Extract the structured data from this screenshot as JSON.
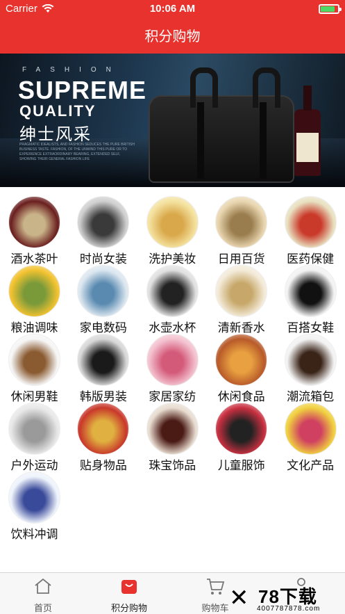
{
  "status_bar": {
    "carrier": "Carrier",
    "time": "10:06 AM",
    "battery_level": 0.85
  },
  "nav": {
    "title": "积分购物"
  },
  "banner": {
    "fashion_text": "FASHION",
    "headline_1": "SUPREME",
    "headline_2": "QUALITY",
    "headline_cn": "绅士风采",
    "small_print": "PRAGMATIC IDEALISTS, AND FASHION SEDUCES THE PURE BRITISH BUSINESS TASTE. FASHION, OF THE UNWIND THIS PURE OR TO EXPERIENCE EXTRAORDINARY BEARING, EXTENDED SELF, SHOWING THEIR GENERAL FASHION LIFE"
  },
  "categories": [
    {
      "label": "酒水茶叶",
      "icon": "wine-tea-icon"
    },
    {
      "label": "时尚女装",
      "icon": "womens-fashion-icon"
    },
    {
      "label": "洗护美妆",
      "icon": "beauty-care-icon"
    },
    {
      "label": "日用百货",
      "icon": "daily-goods-icon"
    },
    {
      "label": "医药保健",
      "icon": "health-medicine-icon"
    },
    {
      "label": "粮油调味",
      "icon": "grain-oil-icon"
    },
    {
      "label": "家电数码",
      "icon": "appliance-digital-icon"
    },
    {
      "label": "水壶水杯",
      "icon": "kettle-cup-icon"
    },
    {
      "label": "清新香水",
      "icon": "perfume-icon"
    },
    {
      "label": "百搭女鞋",
      "icon": "womens-shoes-icon"
    },
    {
      "label": "休闲男鞋",
      "icon": "mens-shoes-icon"
    },
    {
      "label": "韩版男装",
      "icon": "mens-fashion-icon"
    },
    {
      "label": "家居家纺",
      "icon": "home-textile-icon"
    },
    {
      "label": "休闲食品",
      "icon": "snack-food-icon"
    },
    {
      "label": "潮流箱包",
      "icon": "bags-icon"
    },
    {
      "label": "户外运动",
      "icon": "outdoor-sports-icon"
    },
    {
      "label": "贴身物品",
      "icon": "intimate-items-icon"
    },
    {
      "label": "珠宝饰品",
      "icon": "jewelry-icon"
    },
    {
      "label": "儿童服饰",
      "icon": "kids-clothing-icon"
    },
    {
      "label": "文化产品",
      "icon": "books-culture-icon"
    },
    {
      "label": "饮料冲调",
      "icon": "beverage-icon"
    }
  ],
  "tabbar": {
    "tabs": [
      {
        "label": "首页",
        "icon": "home-icon"
      },
      {
        "label": "积分购物",
        "icon": "shopping-bag-icon",
        "active": true
      },
      {
        "label": "购物车",
        "icon": "cart-icon"
      },
      {
        "label": "",
        "icon": "profile-icon"
      }
    ]
  },
  "watermark": {
    "title": "78下载",
    "url": "4007787878.com"
  },
  "colors": {
    "brand_red": "#e8322d",
    "tab_active": "#e8322d"
  }
}
